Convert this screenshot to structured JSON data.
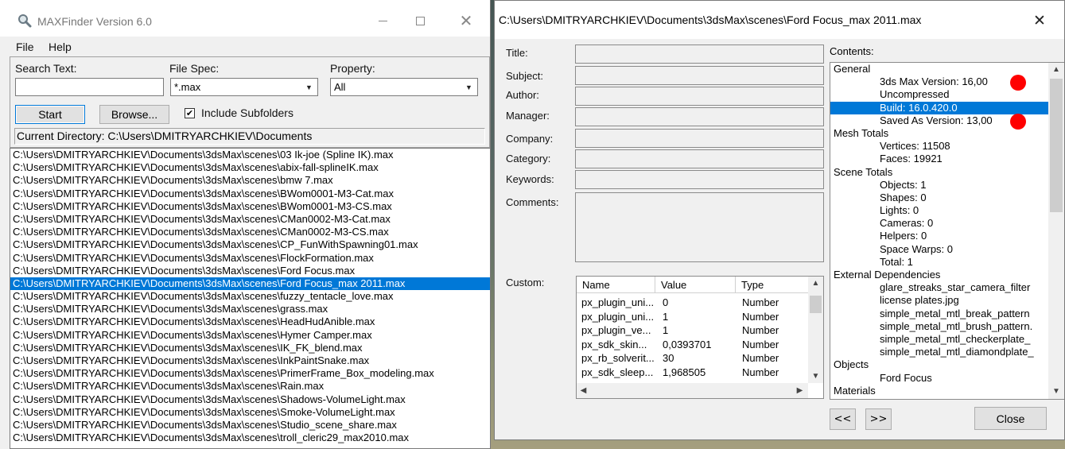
{
  "left_window": {
    "title": "MAXFinder Version 6.0",
    "menu": [
      "File",
      "Help"
    ],
    "search_label": "Search Text:",
    "search_value": "",
    "filespec_label": "File Spec:",
    "filespec_value": "*.max",
    "property_label": "Property:",
    "property_value": "All",
    "start_label": "Start",
    "browse_label": "Browse...",
    "include_subfolders_label": "Include Subfolders",
    "include_subfolders_checked": true,
    "current_directory": "Current Directory: C:\\Users\\DMITRYARCHKIEV\\Documents",
    "files": [
      "C:\\Users\\DMITRYARCHKIEV\\Documents\\3dsMax\\scenes\\03 Ik-joe (Spline IK).max",
      "C:\\Users\\DMITRYARCHKIEV\\Documents\\3dsMax\\scenes\\abix-fall-splineIK.max",
      "C:\\Users\\DMITRYARCHKIEV\\Documents\\3dsMax\\scenes\\bmw 7.max",
      "C:\\Users\\DMITRYARCHKIEV\\Documents\\3dsMax\\scenes\\BWom0001-M3-Cat.max",
      "C:\\Users\\DMITRYARCHKIEV\\Documents\\3dsMax\\scenes\\BWom0001-M3-CS.max",
      "C:\\Users\\DMITRYARCHKIEV\\Documents\\3dsMax\\scenes\\CMan0002-M3-Cat.max",
      "C:\\Users\\DMITRYARCHKIEV\\Documents\\3dsMax\\scenes\\CMan0002-M3-CS.max",
      "C:\\Users\\DMITRYARCHKIEV\\Documents\\3dsMax\\scenes\\CP_FunWithSpawning01.max",
      "C:\\Users\\DMITRYARCHKIEV\\Documents\\3dsMax\\scenes\\FlockFormation.max",
      "C:\\Users\\DMITRYARCHKIEV\\Documents\\3dsMax\\scenes\\Ford Focus.max",
      "C:\\Users\\DMITRYARCHKIEV\\Documents\\3dsMax\\scenes\\Ford Focus_max 2011.max",
      "C:\\Users\\DMITRYARCHKIEV\\Documents\\3dsMax\\scenes\\fuzzy_tentacle_love.max",
      "C:\\Users\\DMITRYARCHKIEV\\Documents\\3dsMax\\scenes\\grass.max",
      "C:\\Users\\DMITRYARCHKIEV\\Documents\\3dsMax\\scenes\\HeadHudAnible.max",
      "C:\\Users\\DMITRYARCHKIEV\\Documents\\3dsMax\\scenes\\Hymer Camper.max",
      "C:\\Users\\DMITRYARCHKIEV\\Documents\\3dsMax\\scenes\\IK_FK_blend.max",
      "C:\\Users\\DMITRYARCHKIEV\\Documents\\3dsMax\\scenes\\InkPaintSnake.max",
      "C:\\Users\\DMITRYARCHKIEV\\Documents\\3dsMax\\scenes\\PrimerFrame_Box_modeling.max",
      "C:\\Users\\DMITRYARCHKIEV\\Documents\\3dsMax\\scenes\\Rain.max",
      "C:\\Users\\DMITRYARCHKIEV\\Documents\\3dsMax\\scenes\\Shadows-VolumeLight.max",
      "C:\\Users\\DMITRYARCHKIEV\\Documents\\3dsMax\\scenes\\Smoke-VolumeLight.max",
      "C:\\Users\\DMITRYARCHKIEV\\Documents\\3dsMax\\scenes\\Studio_scene_share.max",
      "C:\\Users\\DMITRYARCHKIEV\\Documents\\3dsMax\\scenes\\troll_cleric29_max2010.max"
    ],
    "selected_file_index": 10
  },
  "right_window": {
    "title": "C:\\Users\\DMITRYARCHKIEV\\Documents\\3dsMax\\scenes\\Ford Focus_max 2011.max",
    "labels": {
      "title": "Title:",
      "subject": "Subject:",
      "author": "Author:",
      "manager": "Manager:",
      "company": "Company:",
      "category": "Category:",
      "keywords": "Keywords:",
      "comments": "Comments:",
      "custom": "Custom:",
      "contents": "Contents:"
    },
    "custom_columns": [
      "Name",
      "Value",
      "Type"
    ],
    "custom_rows": [
      {
        "name": "px_plugin_uni...",
        "value": "0",
        "type": "Number"
      },
      {
        "name": "px_plugin_uni...",
        "value": "1",
        "type": "Number"
      },
      {
        "name": "px_plugin_ve...",
        "value": "1",
        "type": "Number"
      },
      {
        "name": "px_sdk_skin...",
        "value": "0,0393701",
        "type": "Number"
      },
      {
        "name": "px_rb_solverit...",
        "value": "30",
        "type": "Number"
      },
      {
        "name": "px_sdk_sleep...",
        "value": "1,968505",
        "type": "Number"
      }
    ],
    "contents": [
      {
        "text": "General",
        "level": 0
      },
      {
        "text": "3ds Max Version: 16,00",
        "level": 1,
        "marked": true
      },
      {
        "text": "Uncompressed",
        "level": 1
      },
      {
        "text": "Build: 16.0.420.0",
        "level": 1,
        "selected": true
      },
      {
        "text": "Saved As Version: 13,00",
        "level": 1,
        "marked": true
      },
      {
        "text": "Mesh Totals",
        "level": 0
      },
      {
        "text": "Vertices: 11508",
        "level": 1
      },
      {
        "text": "Faces: 19921",
        "level": 1
      },
      {
        "text": "Scene Totals",
        "level": 0
      },
      {
        "text": "Objects: 1",
        "level": 1
      },
      {
        "text": "Shapes: 0",
        "level": 1
      },
      {
        "text": "Lights: 0",
        "level": 1
      },
      {
        "text": "Cameras: 0",
        "level": 1
      },
      {
        "text": "Helpers: 0",
        "level": 1
      },
      {
        "text": "Space Warps: 0",
        "level": 1
      },
      {
        "text": "Total: 1",
        "level": 1
      },
      {
        "text": "External Dependencies",
        "level": 0
      },
      {
        "text": "glare_streaks_star_camera_filter",
        "level": 1
      },
      {
        "text": "license plates.jpg",
        "level": 1
      },
      {
        "text": "simple_metal_mtl_break_pattern",
        "level": 1
      },
      {
        "text": "simple_metal_mtl_brush_pattern.",
        "level": 1
      },
      {
        "text": "simple_metal_mtl_checkerplate_",
        "level": 1
      },
      {
        "text": "simple_metal_mtl_diamondplate_",
        "level": 1
      },
      {
        "text": "Objects",
        "level": 0
      },
      {
        "text": "Ford Focus",
        "level": 1
      },
      {
        "text": "Materials",
        "level": 0
      }
    ],
    "prev_label": "<<",
    "next_label": ">>",
    "close_label": "Close"
  },
  "colors": {
    "selection": "#0078d7",
    "marker": "#ff0000",
    "dialog_bg": "#f0f0f0"
  },
  "icons": {
    "app": "magnifier-icon",
    "minimize": "minimize-icon",
    "maximize": "maximize-icon",
    "close": "close-icon"
  }
}
